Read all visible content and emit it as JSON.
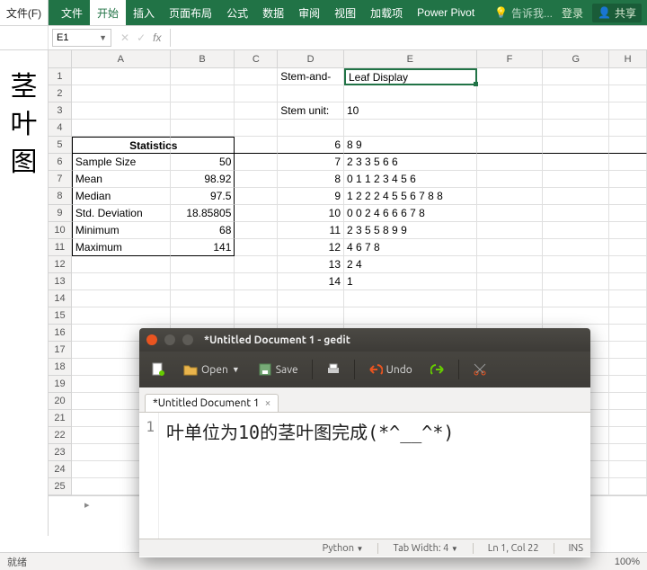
{
  "excel": {
    "file_menu": "文件(F)",
    "tabs": [
      "文件",
      "开始",
      "插入",
      "页面布局",
      "公式",
      "数据",
      "审阅",
      "视图",
      "加载项",
      "Power Pivot"
    ],
    "tell_me": "告诉我...",
    "login": "登录",
    "share": "共享",
    "name_box": "E1",
    "fx_label": "fx",
    "columns": [
      "A",
      "B",
      "C",
      "D",
      "E",
      "F",
      "G",
      "H"
    ],
    "side_title": "茎叶图",
    "cells": {
      "D1": "Stem-and-",
      "E1": "Leaf Display",
      "D3": "Stem unit:",
      "E3": "10",
      "stats_header": "Statistics",
      "A6": "Sample Size",
      "B6": "50",
      "A7": "Mean",
      "B7": "98.92",
      "A8": "Median",
      "B8": "97.5",
      "A9": "Std. Deviation",
      "B9": "18.85805",
      "A10": "Minimum",
      "B10": "68",
      "A11": "Maximum",
      "B11": "141",
      "D5": "6",
      "E5": "8 9",
      "D6": "7",
      "E6": "2 3 3 5 6 6",
      "D7": "8",
      "E7": "0 1 1 2 3 4 5 6",
      "D8": "9",
      "E8": "1 2 2 2 4 5 5 6 7 8 8",
      "D9": "10",
      "E9": "0 0 2 4 6 6 6 7 8",
      "D10": "11",
      "E10": "2 3 5 5 8 9 9",
      "D11": "12",
      "E11": "4 6 7 8",
      "D12": "13",
      "E12": "2 4",
      "D13": "14",
      "E13": "1"
    },
    "status_ready": "就绪",
    "zoom": "100%"
  },
  "gedit": {
    "title": "*Untitled Document 1 - gedit",
    "open": "Open",
    "save": "Save",
    "undo": "Undo",
    "tab": "*Untitled Document 1",
    "line_no": "1",
    "content": "叶单位为10的茎叶图完成(*^__^*)",
    "lang": "Python",
    "tabwidth": "Tab Width: 4",
    "pos": "Ln 1, Col 22",
    "ins": "INS"
  }
}
